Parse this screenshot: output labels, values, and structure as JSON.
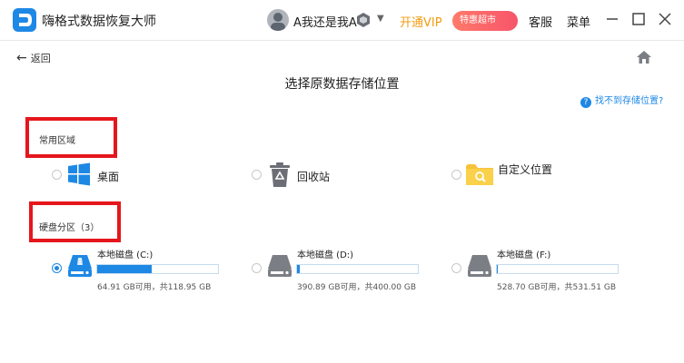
{
  "app": {
    "title": "嗨格式数据恢复大师"
  },
  "user": {
    "name": "A我还是我A"
  },
  "header": {
    "vip_label": "开通VIP",
    "promo_label": "特惠超市",
    "service_label": "客服",
    "menu_label": "菜单"
  },
  "nav": {
    "back_label": "返回"
  },
  "page": {
    "title": "选择原数据存储位置",
    "help_link": "找不到存储位置?"
  },
  "common": {
    "label": "常用区域",
    "items": [
      {
        "label": "桌面",
        "icon": "windows-icon",
        "selected": false
      },
      {
        "label": "回收站",
        "icon": "recycle-bin-icon",
        "selected": false
      },
      {
        "label": "自定义位置",
        "icon": "folder-search-icon",
        "selected": false
      }
    ]
  },
  "drives": {
    "label": "硬盘分区（3）",
    "items": [
      {
        "name": "本地磁盘 (C:)",
        "free": "64.91 GB可用，共118.95 GB",
        "used_fraction": 0.45,
        "selected": true
      },
      {
        "name": "本地磁盘 (D:)",
        "free": "390.89 GB可用，共400.00 GB",
        "used_fraction": 0.02,
        "selected": false
      },
      {
        "name": "本地磁盘 (F:)",
        "free": "528.70 GB可用，共531.51 GB",
        "used_fraction": 0.01,
        "selected": false
      }
    ]
  },
  "colors": {
    "accent": "#1e88e5",
    "highlight_box": "#e5161c",
    "vip": "#f39c12"
  }
}
